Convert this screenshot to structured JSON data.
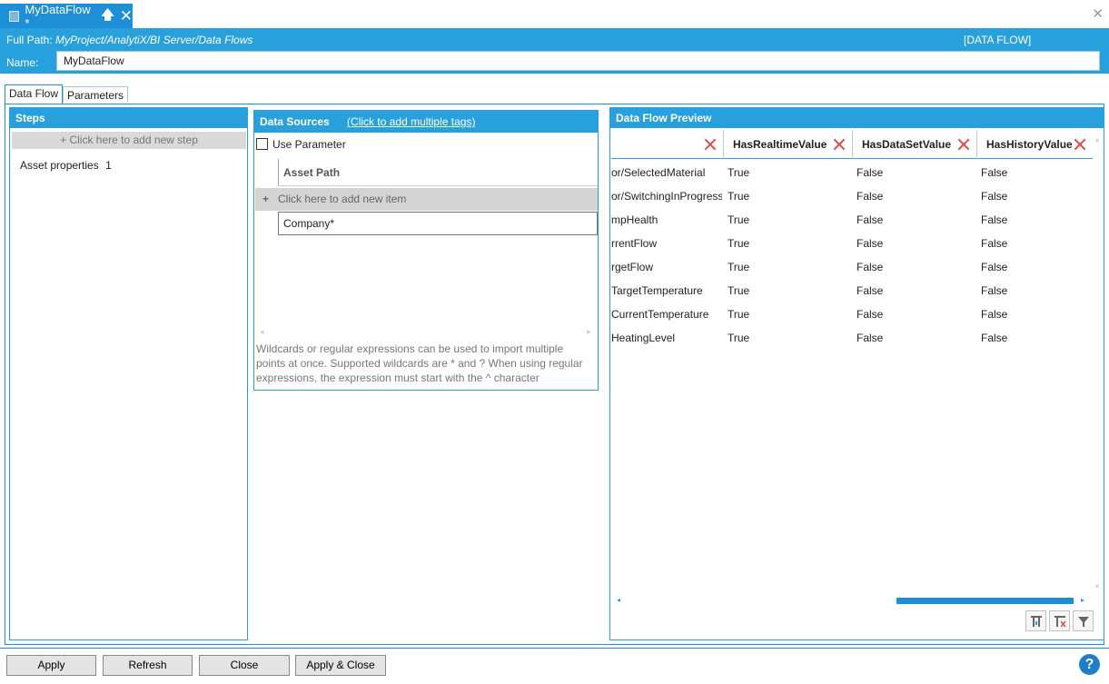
{
  "tab": {
    "title": "MyDataFlow *",
    "pin_icon": "pin-up-icon",
    "close_icon": "close-icon"
  },
  "header": {
    "fullpath_label": "Full Path:",
    "fullpath_value": "MyProject/AnalytiX/BI Server/Data Flows",
    "type_label": "[DATA FLOW]",
    "name_label": "Name:",
    "name_value": "MyDataFlow"
  },
  "tabs": [
    {
      "label": "Data Flow"
    },
    {
      "label": "Parameters"
    }
  ],
  "steps": {
    "title": "Steps",
    "add_label": "+ Click here to add new step",
    "items": [
      {
        "label": "Asset properties",
        "count": "1"
      }
    ]
  },
  "data_sources": {
    "title": "Data Sources",
    "link": "(Click to add multiple tags)",
    "use_parameter": "Use Parameter",
    "column_header": "Asset Path",
    "add_label": "Click here to add new item",
    "rows": [
      "Company*"
    ],
    "help_text": "Wildcards or regular expressions can be used to import multiple points at once. Supported wildcards are * and ? When using regular expressions, the expression must start with the ^ character"
  },
  "preview": {
    "title": "Data Flow Preview",
    "columns": [
      "",
      "HasRealtimeValue",
      "HasDataSetValue",
      "HasHistoryValue"
    ],
    "rows": [
      [
        "or/SelectedMaterial",
        "True",
        "False",
        "False"
      ],
      [
        "or/SwitchingInProgress",
        "True",
        "False",
        "False"
      ],
      [
        "mpHealth",
        "True",
        "False",
        "False"
      ],
      [
        "rrentFlow",
        "True",
        "False",
        "False"
      ],
      [
        "rgetFlow",
        "True",
        "False",
        "False"
      ],
      [
        "TargetTemperature",
        "True",
        "False",
        "False"
      ],
      [
        "CurrentTemperature",
        "True",
        "False",
        "False"
      ],
      [
        "HeatingLevel",
        "True",
        "False",
        "False"
      ]
    ]
  },
  "buttons": {
    "apply": "Apply",
    "refresh": "Refresh",
    "close": "Close",
    "apply_close": "Apply & Close"
  },
  "help": "?"
}
